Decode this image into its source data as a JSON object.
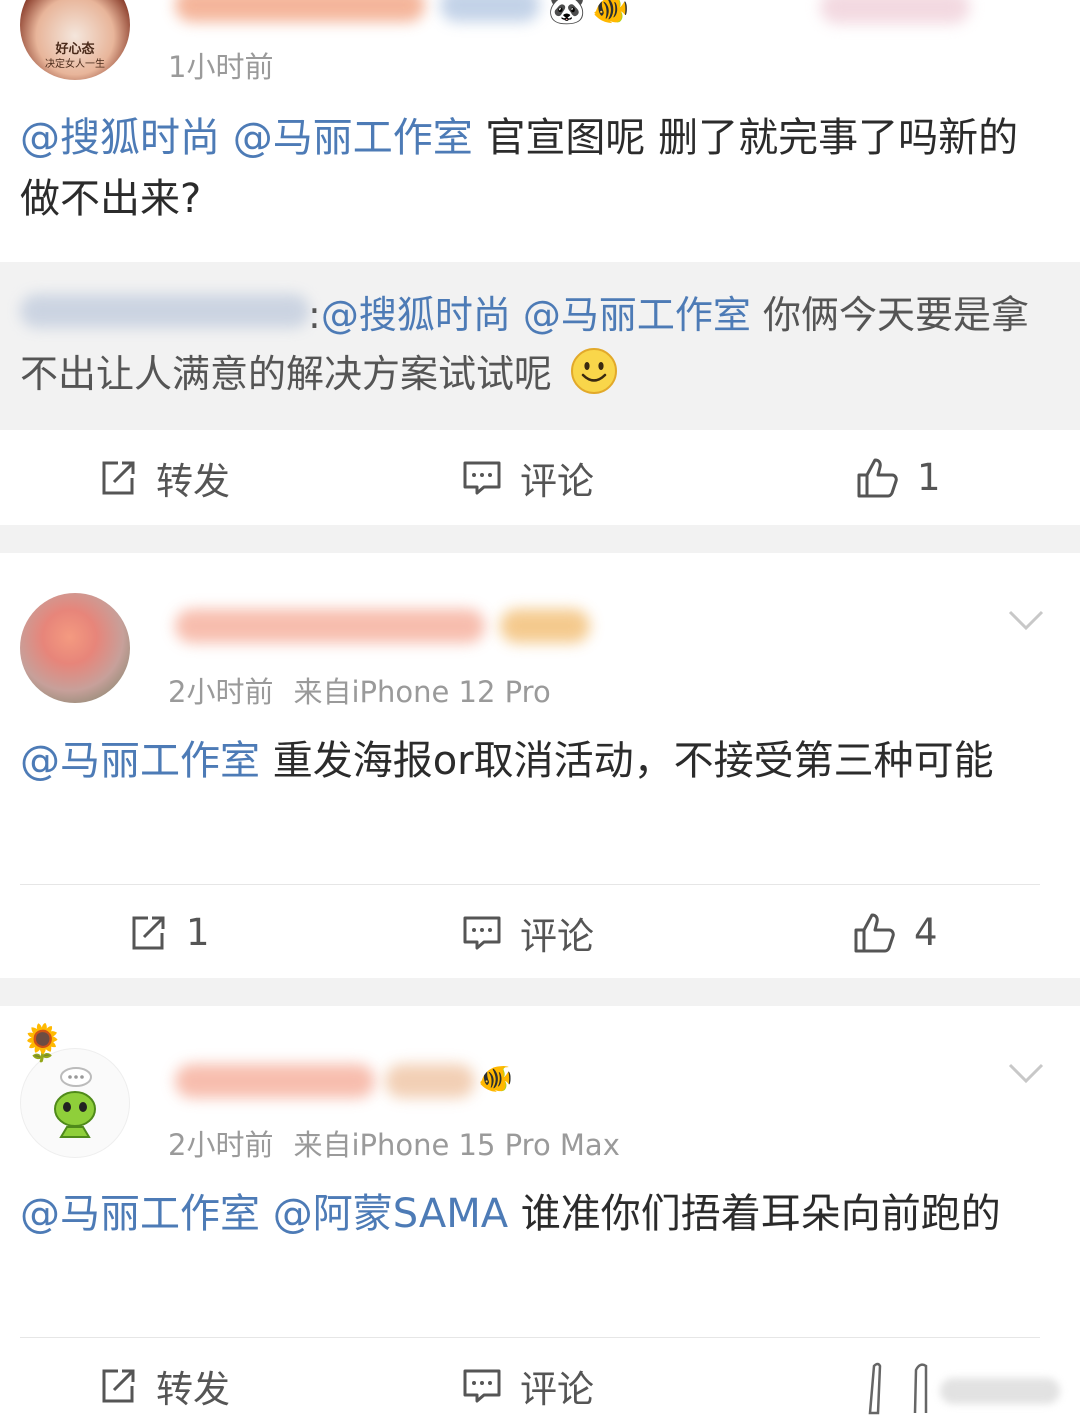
{
  "posts": [
    {
      "time": "1小时前",
      "content": [
        {
          "text": "@搜狐时尚",
          "mention": true
        },
        {
          "text": " ",
          "mention": false
        },
        {
          "text": "@马丽工作室",
          "mention": true
        },
        {
          "text": " 官宣图呢 删了就完事了吗新的做不出来?",
          "mention": false
        }
      ],
      "quote": [
        {
          "text": ":",
          "mention": false
        },
        {
          "text": "@搜狐时尚",
          "mention": true
        },
        {
          "text": " ",
          "mention": false
        },
        {
          "text": "@马丽工作室",
          "mention": true
        },
        {
          "text": " 你俩今天要是拿不出让人满意的解决方案试试呢",
          "mention": false
        }
      ],
      "quote_emoji": "smile-emoji",
      "actions": {
        "repost": "转发",
        "comment": "评论",
        "like": "1"
      }
    },
    {
      "time": "2小时前",
      "source": "来自iPhone 12 Pro",
      "content": [
        {
          "text": "@马丽工作室",
          "mention": true
        },
        {
          "text": " 重发海报or取消活动，不接受第三种可能",
          "mention": false
        }
      ],
      "actions": {
        "repost": "1",
        "comment": "评论",
        "like": "4"
      }
    },
    {
      "time": "2小时前",
      "source": "来自iPhone 15 Pro Max",
      "content": [
        {
          "text": "@马丽工作室",
          "mention": true
        },
        {
          "text": " ",
          "mention": false
        },
        {
          "text": "@阿蒙SAMA",
          "mention": true
        },
        {
          "text": " 谁准你们捂着耳朵向前跑的",
          "mention": false
        }
      ],
      "actions": {
        "repost": "转发",
        "comment": "评论"
      }
    }
  ],
  "avatar1_text": [
    "好心态",
    "决定女人一生"
  ],
  "colors": {
    "mention": "#4d7bb6",
    "background": "#f2f2f2",
    "card": "#ffffff",
    "meta": "#9a9a9a"
  }
}
